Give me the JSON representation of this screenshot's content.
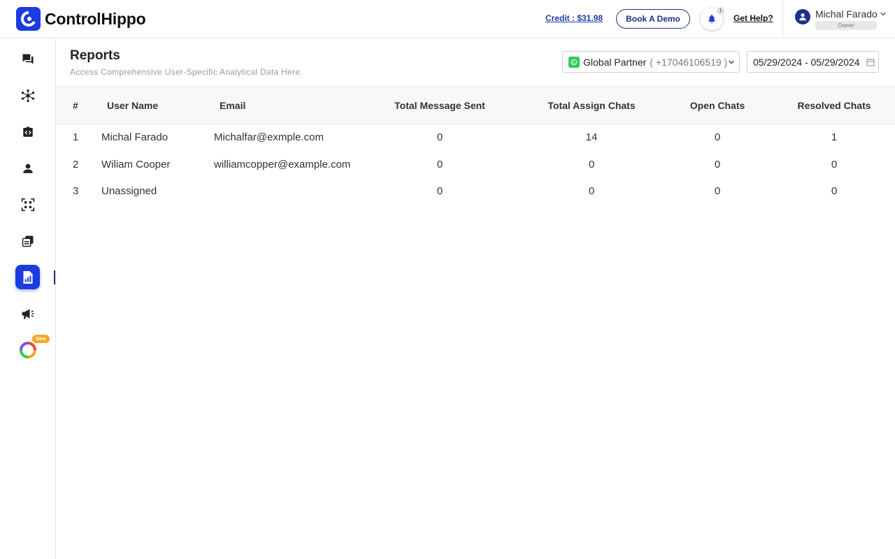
{
  "brand": {
    "name": "ControlHippo"
  },
  "header": {
    "credit": "Credit : $31.98",
    "book_demo": "Book A Demo",
    "notification_count": "1",
    "get_help": "Get Help?",
    "user_name": "Michal Farado",
    "user_role": "Owner"
  },
  "sidebar": {
    "items": [
      {
        "icon": "chat-icon"
      },
      {
        "icon": "network-icon"
      },
      {
        "icon": "code-icon"
      },
      {
        "icon": "user-icon"
      },
      {
        "icon": "qr-code-icon"
      },
      {
        "icon": "templates-icon"
      },
      {
        "icon": "reports-icon",
        "active": true
      },
      {
        "icon": "megaphone-icon"
      },
      {
        "icon": "hippo-ai-icon"
      }
    ],
    "new_badge": "New"
  },
  "page": {
    "title": "Reports",
    "subtitle": "Access Comprehensive User-Specific Analytical Data Here."
  },
  "filters": {
    "account_name": "Global Partner",
    "account_phone": "( +17046106519 )",
    "date_range": "05/29/2024 - 05/29/2024"
  },
  "table": {
    "headers": [
      "#",
      "User Name",
      "Email",
      "Total Message Sent",
      "Total Assign Chats",
      "Open Chats",
      "Resolved Chats"
    ],
    "rows": [
      [
        "1",
        "Michal Farado",
        "Michalfar@exmple.com",
        "0",
        "14",
        "0",
        "1"
      ],
      [
        "2",
        "Wiliam Cooper",
        "williamcopper@example.com",
        "0",
        "0",
        "0",
        "0"
      ],
      [
        "3",
        "Unassigned",
        "",
        "0",
        "0",
        "0",
        "0"
      ]
    ]
  },
  "colors": {
    "brand": "#1c3ce0",
    "navy": "#1c2f8a",
    "whatsapp": "#2ecc57",
    "badge": "#f5a623"
  }
}
